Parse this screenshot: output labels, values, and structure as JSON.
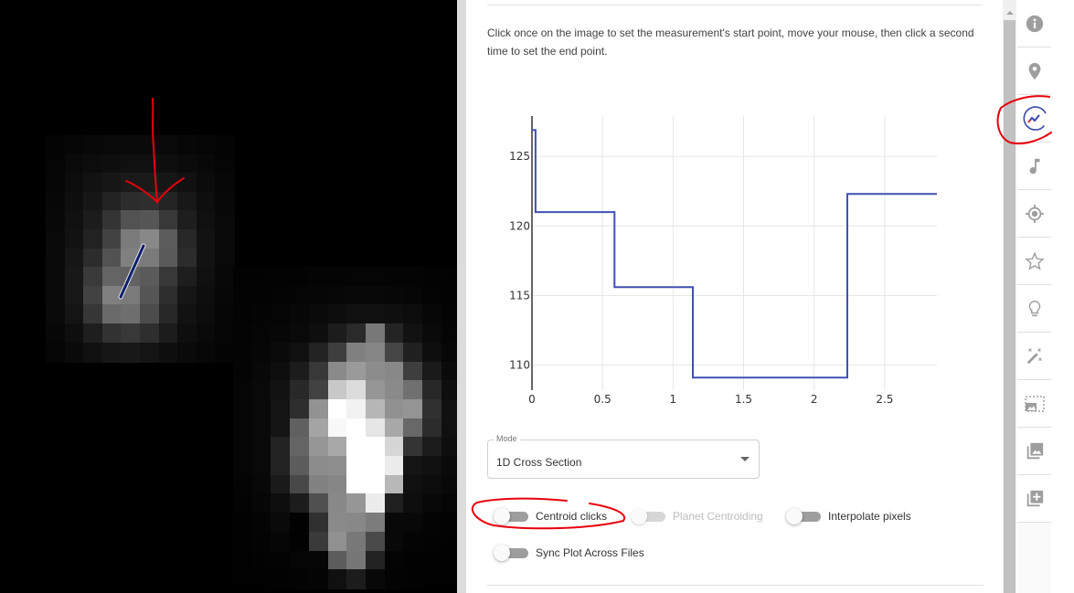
{
  "viewer": {
    "measurement_line_color": "#0d1f6e",
    "annotation_color": "#e8000b",
    "stars": [
      {
        "name": "star-1",
        "cols": 10,
        "rows": 12,
        "grey": [
          [
            4,
            6,
            8,
            9,
            10,
            10,
            9,
            7,
            5,
            4
          ],
          [
            5,
            9,
            12,
            14,
            16,
            16,
            14,
            11,
            8,
            5
          ],
          [
            6,
            12,
            18,
            22,
            26,
            26,
            22,
            17,
            11,
            7
          ],
          [
            7,
            14,
            22,
            34,
            44,
            46,
            36,
            24,
            14,
            8
          ],
          [
            8,
            16,
            28,
            52,
            82,
            86,
            56,
            30,
            16,
            9
          ],
          [
            9,
            18,
            34,
            66,
            122,
            136,
            92,
            40,
            18,
            9
          ],
          [
            10,
            22,
            44,
            82,
            128,
            122,
            90,
            44,
            18,
            9
          ],
          [
            10,
            24,
            58,
            100,
            98,
            90,
            56,
            30,
            16,
            8
          ],
          [
            10,
            24,
            66,
            128,
            122,
            86,
            46,
            22,
            14,
            7
          ],
          [
            9,
            20,
            54,
            106,
            110,
            76,
            40,
            18,
            12,
            6
          ],
          [
            7,
            14,
            30,
            50,
            56,
            46,
            28,
            14,
            9,
            5
          ],
          [
            5,
            10,
            16,
            22,
            24,
            20,
            14,
            10,
            7,
            4
          ]
        ]
      },
      {
        "name": "star-2",
        "cols": 12,
        "rows": 17,
        "grey": [
          [
            2,
            2,
            3,
            3,
            4,
            4,
            5,
            5,
            4,
            4,
            3,
            2
          ],
          [
            3,
            3,
            4,
            5,
            6,
            7,
            8,
            8,
            7,
            6,
            4,
            3
          ],
          [
            3,
            4,
            5,
            7,
            10,
            13,
            16,
            17,
            15,
            12,
            7,
            4
          ],
          [
            4,
            5,
            7,
            9,
            14,
            28,
            42,
            120,
            36,
            18,
            10,
            5
          ],
          [
            4,
            6,
            10,
            16,
            34,
            62,
            128,
            134,
            70,
            32,
            14,
            7
          ],
          [
            4,
            8,
            14,
            28,
            56,
            138,
            154,
            140,
            136,
            62,
            26,
            10
          ],
          [
            5,
            9,
            18,
            40,
            66,
            200,
            220,
            150,
            138,
            112,
            40,
            14
          ],
          [
            5,
            9,
            20,
            46,
            146,
            255,
            242,
            182,
            144,
            148,
            48,
            16
          ],
          [
            5,
            9,
            20,
            96,
            164,
            248,
            255,
            230,
            168,
            104,
            44,
            16
          ],
          [
            5,
            9,
            34,
            100,
            150,
            168,
            255,
            255,
            214,
            52,
            28,
            14
          ],
          [
            5,
            9,
            34,
            92,
            140,
            142,
            255,
            255,
            236,
            20,
            16,
            10
          ],
          [
            4,
            8,
            26,
            72,
            130,
            134,
            255,
            255,
            184,
            16,
            12,
            8
          ],
          [
            3,
            6,
            14,
            28,
            80,
            136,
            150,
            236,
            32,
            14,
            8,
            5
          ],
          [
            2,
            4,
            10,
            2,
            48,
            138,
            136,
            124,
            8,
            8,
            4,
            3
          ],
          [
            2,
            3,
            6,
            2,
            58,
            144,
            120,
            74,
            8,
            4,
            3,
            2
          ],
          [
            1,
            2,
            3,
            5,
            6,
            92,
            118,
            34,
            4,
            2,
            2,
            1
          ],
          [
            1,
            1,
            2,
            3,
            4,
            16,
            28,
            8,
            3,
            2,
            1,
            1
          ]
        ]
      }
    ]
  },
  "panel": {
    "instructions": "Click once on the image to set the measurement's start point, move your mouse, then click a second time to set the end point.",
    "mode": {
      "label": "Mode",
      "value": "1D Cross Section"
    },
    "toggles": [
      {
        "label": "Centroid clicks",
        "on": false,
        "disabled": false
      },
      {
        "label": "Planet Centroiding",
        "on": false,
        "disabled": true
      },
      {
        "label": "Interpolate pixels",
        "on": false,
        "disabled": false
      },
      {
        "label": "Sync Plot Across Files",
        "on": false,
        "disabled": false
      }
    ]
  },
  "sidebar": {
    "items": [
      {
        "icon": "info-icon",
        "active": false
      },
      {
        "icon": "location-pin-icon",
        "active": false
      },
      {
        "icon": "line-chart-icon",
        "active": true
      },
      {
        "icon": "music-note-icon",
        "active": false
      },
      {
        "icon": "crosshair-icon",
        "active": false
      },
      {
        "icon": "star-icon",
        "active": false
      },
      {
        "icon": "lightbulb-icon",
        "active": false
      },
      {
        "icon": "magic-wand-icon",
        "active": false
      },
      {
        "icon": "image-crop-icon",
        "active": false
      },
      {
        "icon": "image-stack-icon",
        "active": false
      },
      {
        "icon": "add-layer-icon",
        "active": false
      }
    ],
    "icon_color": "#9e9e9e",
    "active_color": "#3949ab"
  },
  "chart_data": {
    "type": "line",
    "line_shape": "step",
    "title": "",
    "xlabel": "",
    "ylabel": "",
    "xlim": [
      0,
      2.87
    ],
    "ylim": [
      108.2,
      127.9
    ],
    "x_ticks": [
      0,
      0.5,
      1,
      1.5,
      2,
      2.5
    ],
    "x_tick_labels": [
      "0",
      "0.5",
      "1",
      "1.5",
      "2",
      "2.5"
    ],
    "y_ticks": [
      110,
      115,
      120,
      125
    ],
    "y_tick_labels": [
      "110",
      "115",
      "120",
      "125"
    ],
    "grid": true,
    "legend": "none",
    "series": [
      {
        "name": "cross-section",
        "color": "#3f51b5",
        "x": [
          0,
          0.025,
          0.025,
          0.585,
          0.585,
          1.14,
          1.14,
          2.235,
          2.235,
          2.87
        ],
        "y": [
          126.9,
          126.9,
          121.0,
          121.0,
          115.6,
          115.6,
          109.1,
          109.1,
          122.3,
          122.3
        ]
      }
    ]
  }
}
